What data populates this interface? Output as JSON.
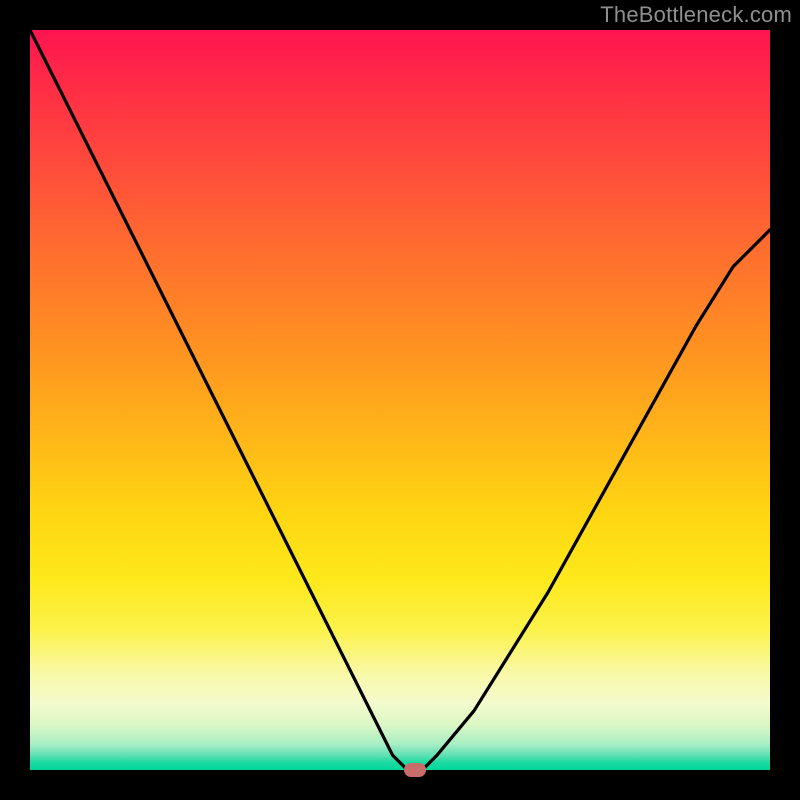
{
  "watermark": "TheBottleneck.com",
  "chart_data": {
    "type": "line",
    "title": "",
    "xlabel": "",
    "ylabel": "",
    "xlim": [
      0,
      100
    ],
    "ylim": [
      0,
      100
    ],
    "grid": false,
    "legend": false,
    "series": [
      {
        "name": "bottleneck-curve",
        "x": [
          0,
          5,
          10,
          15,
          20,
          25,
          30,
          35,
          40,
          45,
          49,
          51,
          53,
          55,
          60,
          65,
          70,
          75,
          80,
          85,
          90,
          95,
          100
        ],
        "values": [
          100,
          90,
          80,
          70,
          60,
          50,
          40,
          30,
          20,
          10,
          2,
          0,
          0,
          2,
          8,
          16,
          24,
          33,
          42,
          51,
          60,
          68,
          73
        ]
      }
    ],
    "annotations": [
      {
        "name": "optimal-point",
        "x": 52,
        "y": 0
      }
    ],
    "background": {
      "type": "vertical-gradient",
      "stops": [
        {
          "pos": 0,
          "color": "#ff1450"
        },
        {
          "pos": 50,
          "color": "#ffb319"
        },
        {
          "pos": 80,
          "color": "#fcf24a"
        },
        {
          "pos": 100,
          "color": "#00d79a"
        }
      ]
    }
  }
}
